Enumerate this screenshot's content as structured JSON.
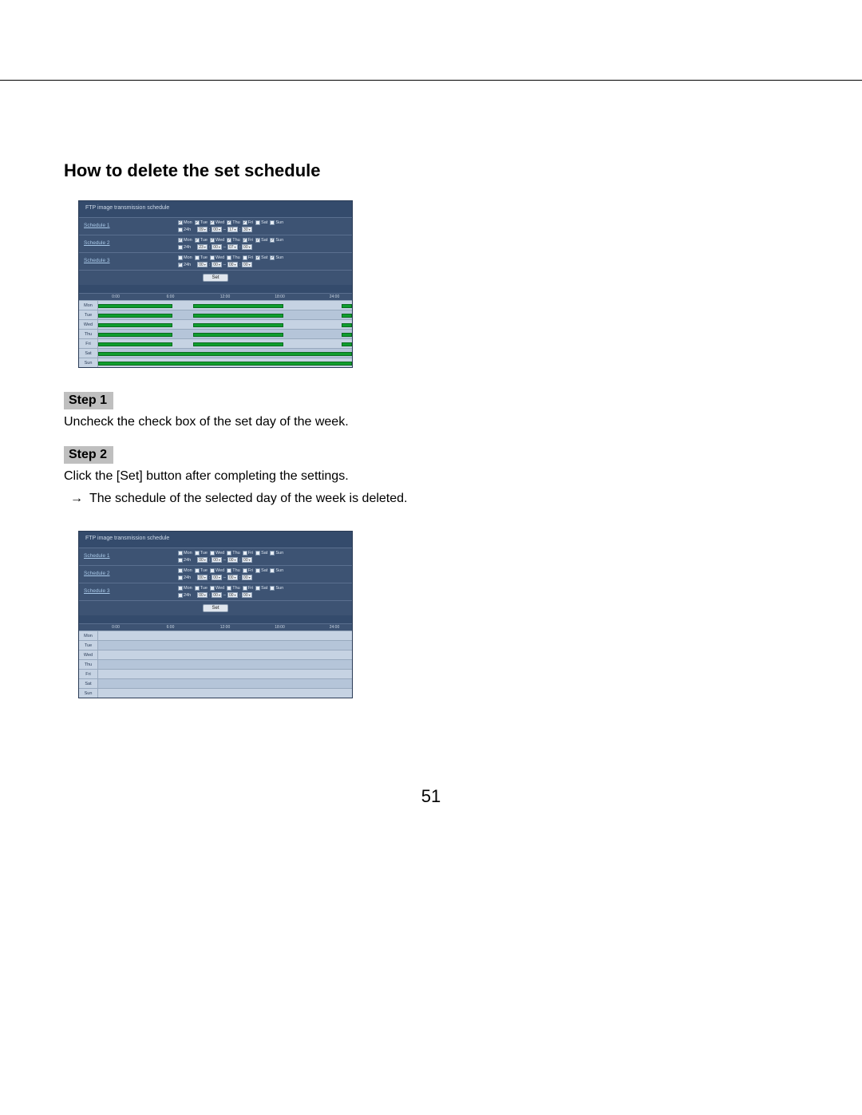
{
  "page": {
    "title": "How to delete the set schedule",
    "step1_label": "Step 1",
    "step1_text": "Uncheck the check box of the set day of the week.",
    "step2_label": "Step 2",
    "step2_text": "Click the [Set] button after completing the settings.",
    "step2_arrow": "→",
    "step2_result": "The schedule of the selected day of the week is deleted.",
    "page_number": "51"
  },
  "panel": {
    "title": "FTP image transmission schedule",
    "sched1": "Schedule 1",
    "sched2": "Schedule 2",
    "sched3": "Schedule 3",
    "days": {
      "mon": "Mon",
      "tue": "Tue",
      "wed": "Wed",
      "thu": "Thu",
      "fri": "Fri",
      "sat": "Sat",
      "sun": "Sun"
    },
    "h24": "24h",
    "sep": "–",
    "colon": ":",
    "set": "Set",
    "time_labels": {
      "t0": "0:00",
      "t6": "6:00",
      "t12": "12:00",
      "t18": "18:00",
      "t24": "24:00"
    }
  },
  "screenshot1": {
    "schedules": [
      {
        "days_checked": {
          "mon": true,
          "tue": true,
          "wed": true,
          "thu": true,
          "fri": true,
          "sat": false,
          "sun": false
        },
        "h24": false,
        "h1": "09",
        "m1": "00",
        "h2": "17",
        "m2": "30"
      },
      {
        "days_checked": {
          "mon": true,
          "tue": true,
          "wed": true,
          "thu": true,
          "fri": true,
          "sat": true,
          "sun": true
        },
        "h24": false,
        "h1": "23",
        "m1": "00",
        "h2": "07",
        "m2": "00"
      },
      {
        "days_checked": {
          "mon": false,
          "tue": false,
          "wed": false,
          "thu": false,
          "fri": false,
          "sat": true,
          "sun": true
        },
        "h24": true,
        "h1": "00",
        "m1": "00",
        "h2": "00",
        "m2": "00"
      }
    ],
    "timeline": {
      "rows": [
        "Mon",
        "Tue",
        "Wed",
        "Thu",
        "Fri",
        "Sat",
        "Sun"
      ],
      "bars": {
        "Mon": [
          [
            0,
            7
          ],
          [
            9,
            17.5
          ],
          [
            23,
            24
          ]
        ],
        "Tue": [
          [
            0,
            7
          ],
          [
            9,
            17.5
          ],
          [
            23,
            24
          ]
        ],
        "Wed": [
          [
            0,
            7
          ],
          [
            9,
            17.5
          ],
          [
            23,
            24
          ]
        ],
        "Thu": [
          [
            0,
            7
          ],
          [
            9,
            17.5
          ],
          [
            23,
            24
          ]
        ],
        "Fri": [
          [
            0,
            7
          ],
          [
            9,
            17.5
          ],
          [
            23,
            24
          ]
        ],
        "Sat": [
          [
            0,
            24
          ]
        ],
        "Sun": [
          [
            0,
            24
          ]
        ]
      }
    }
  },
  "screenshot2": {
    "schedules": [
      {
        "days_checked": {
          "mon": false,
          "tue": false,
          "wed": false,
          "thu": false,
          "fri": false,
          "sat": false,
          "sun": false
        },
        "h24": false,
        "h1": "00",
        "m1": "00",
        "h2": "00",
        "m2": "00"
      },
      {
        "days_checked": {
          "mon": false,
          "tue": false,
          "wed": false,
          "thu": false,
          "fri": false,
          "sat": false,
          "sun": false
        },
        "h24": false,
        "h1": "00",
        "m1": "00",
        "h2": "00",
        "m2": "00"
      },
      {
        "days_checked": {
          "mon": false,
          "tue": false,
          "wed": false,
          "thu": false,
          "fri": false,
          "sat": false,
          "sun": false
        },
        "h24": false,
        "h1": "00",
        "m1": "00",
        "h2": "00",
        "m2": "00"
      }
    ],
    "timeline": {
      "rows": [
        "Mon",
        "Tue",
        "Wed",
        "Thu",
        "Fri",
        "Sat",
        "Sun"
      ],
      "bars": {
        "Mon": [],
        "Tue": [],
        "Wed": [],
        "Thu": [],
        "Fri": [],
        "Sat": [],
        "Sun": []
      }
    }
  }
}
